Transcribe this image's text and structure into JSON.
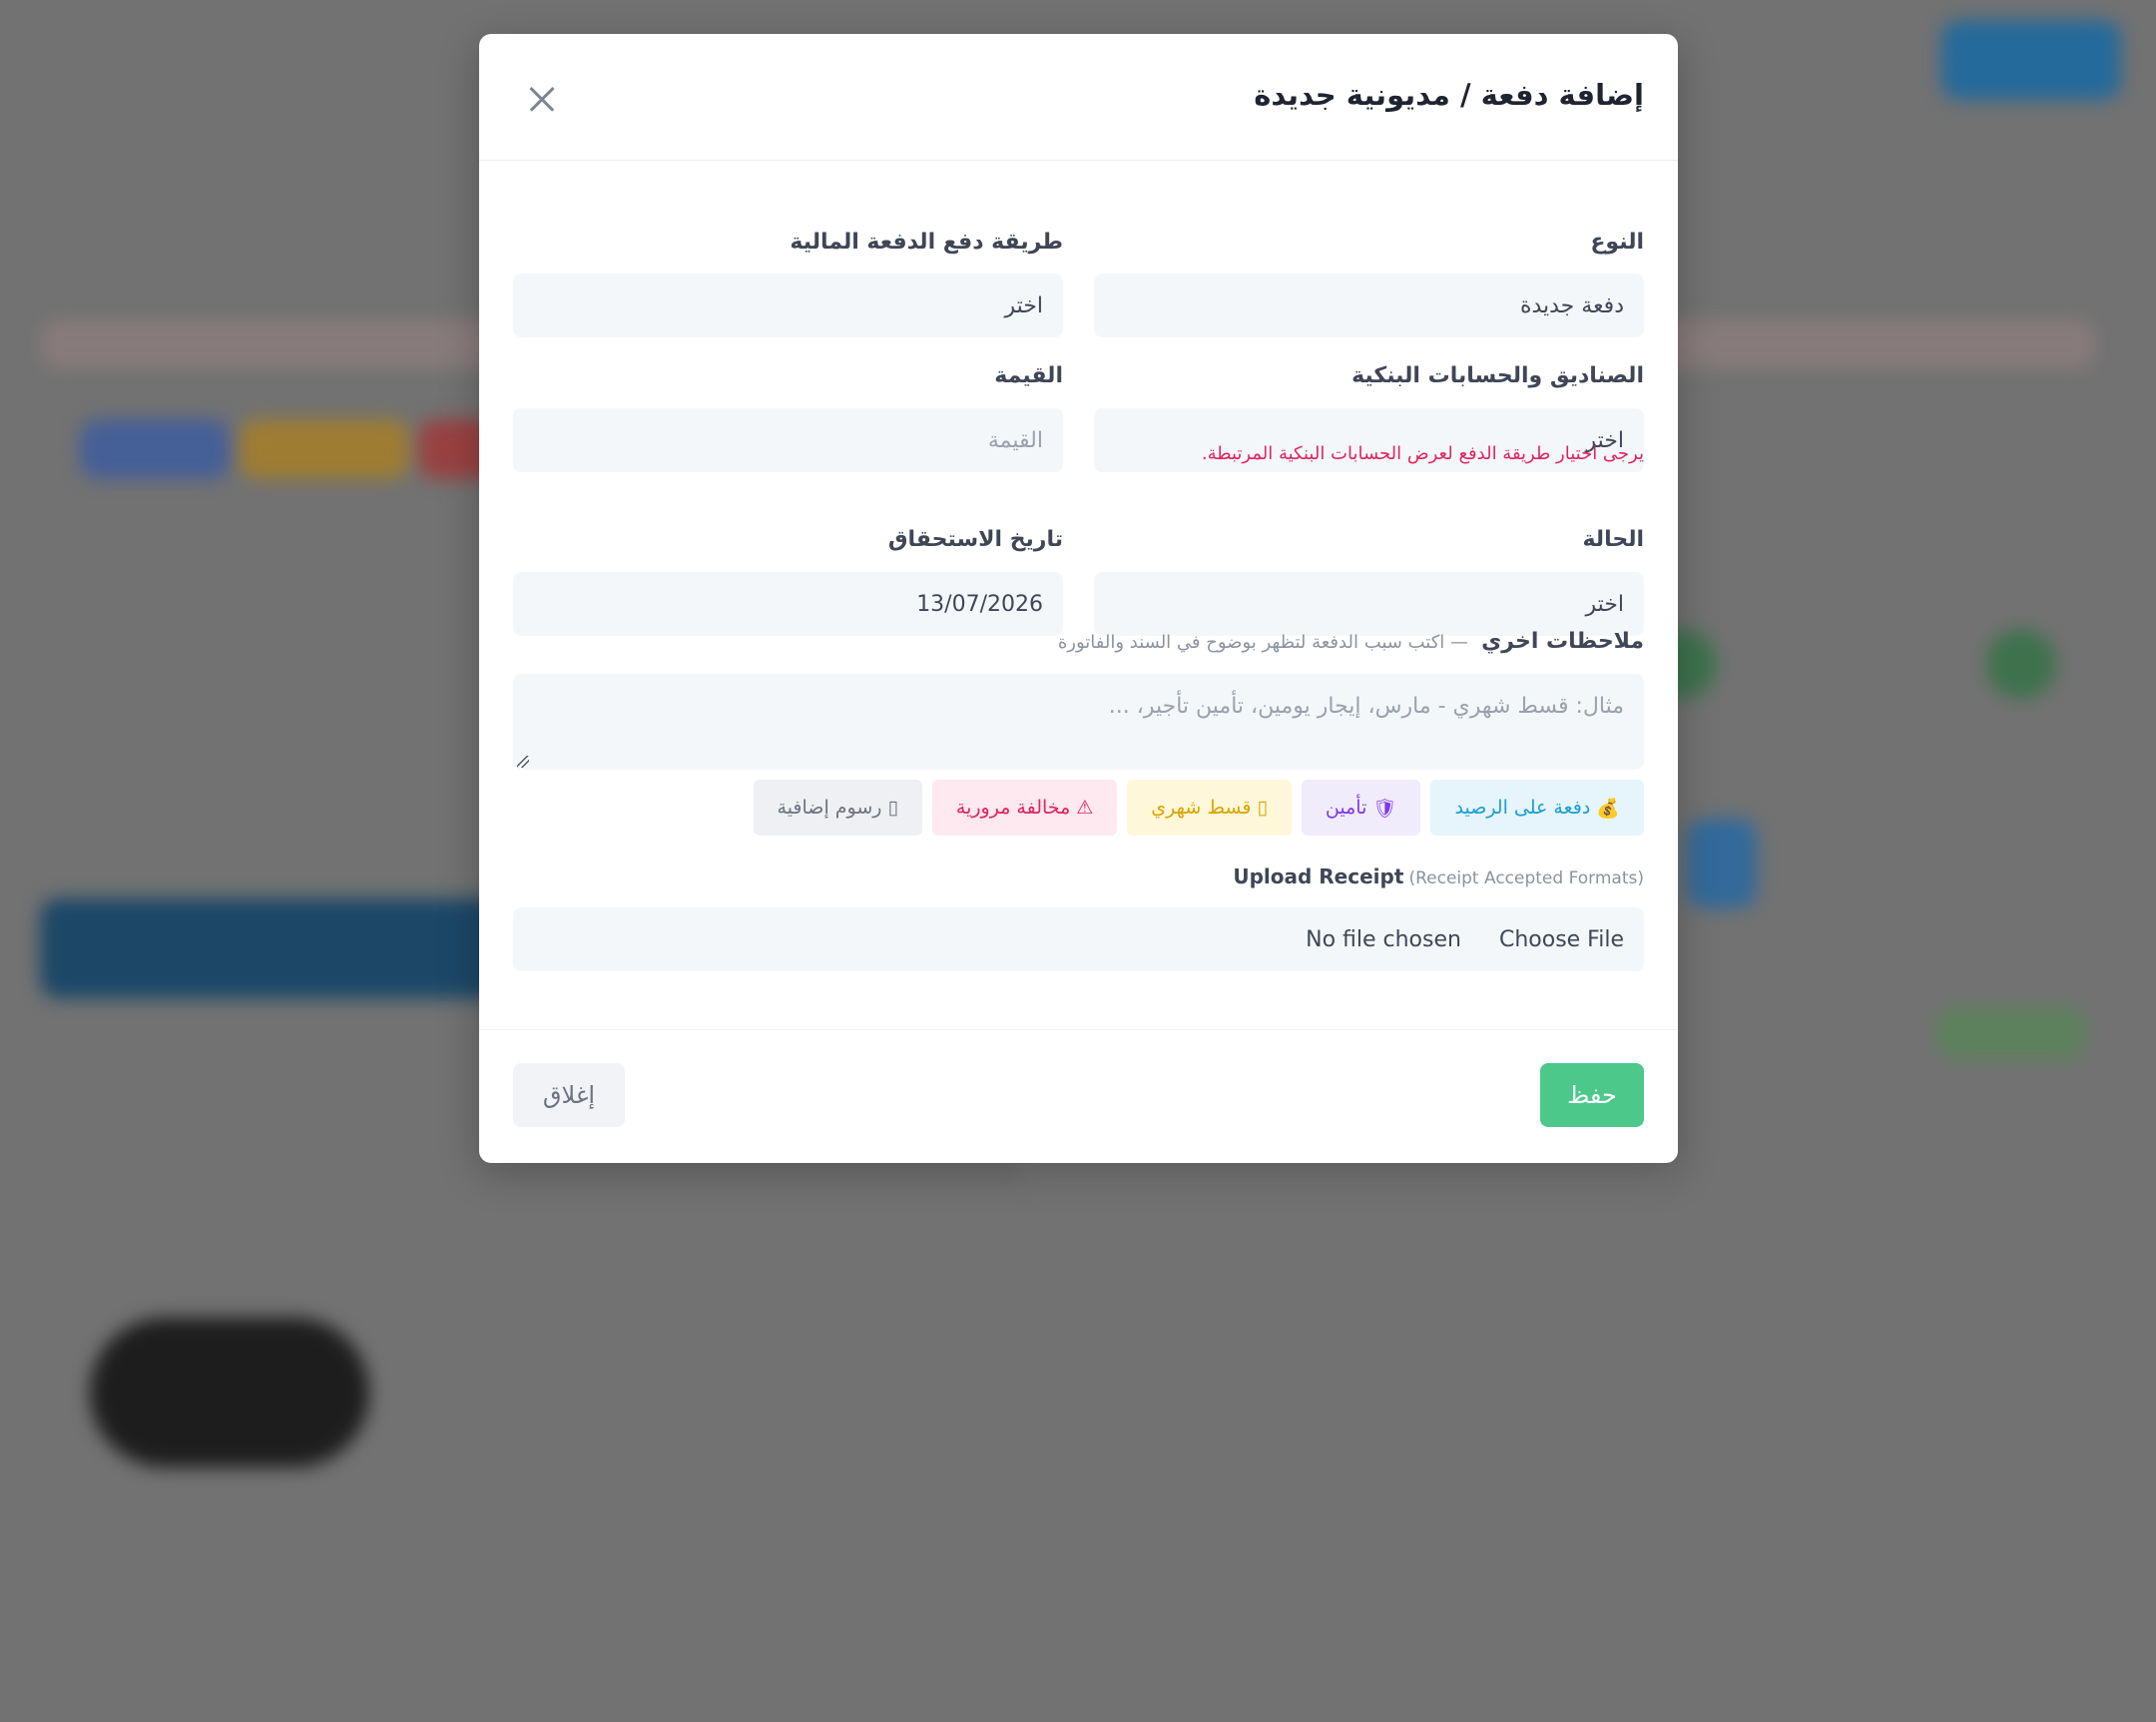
{
  "modal": {
    "title": "إضافة دفعة / مديونية جديدة"
  },
  "form": {
    "type": {
      "label": "النوع",
      "value": "دفعة جديدة"
    },
    "payment_method": {
      "label": "طريقة دفع الدفعة المالية",
      "value": "اختر"
    },
    "boxes": {
      "label": "الصناديق والحسابات البنكية",
      "value": "اختر",
      "error": "يرجى اختيار طريقة الدفع لعرض الحسابات البنكية المرتبطة."
    },
    "amount": {
      "label": "القيمة",
      "placeholder": "القيمة"
    },
    "status": {
      "label": "الحالة",
      "value": "اختر"
    },
    "due_date": {
      "label": "تاريخ الاستحقاق",
      "value": "13/07/2026"
    },
    "notes": {
      "label": "ملاحظات اخري",
      "hint": "— اكتب سبب الدفعة لتظهر بوضوح في السند والفاتورة",
      "placeholder": "مثال: قسط شهري - مارس، إيجار يومين، تأمين تأجير، ..."
    },
    "chips": [
      {
        "icon": "💰",
        "label": "دفعة على الرصيد",
        "bg": "#e6f5fb",
        "color": "#1a9fd0"
      },
      {
        "icon": "🛡",
        "label": "تأمين",
        "bg": "#f1ecfb",
        "color": "#7c3aed"
      },
      {
        "icon": "▯",
        "label": "قسط شهري",
        "bg": "#fff7d9",
        "color": "#d9a400"
      },
      {
        "icon": "⚠",
        "label": "مخالفة مرورية",
        "bg": "#fde9ef",
        "color": "#e0245e"
      },
      {
        "icon": "▯",
        "label": "رسوم إضافية",
        "bg": "#eef0f3",
        "color": "#6b7280"
      }
    ],
    "upload": {
      "label": "Upload Receipt",
      "sub": "(Receipt Accepted Formats)",
      "button": "Choose File",
      "status": "No file chosen"
    }
  },
  "footer": {
    "save": "حفظ",
    "close": "إغلاق"
  }
}
